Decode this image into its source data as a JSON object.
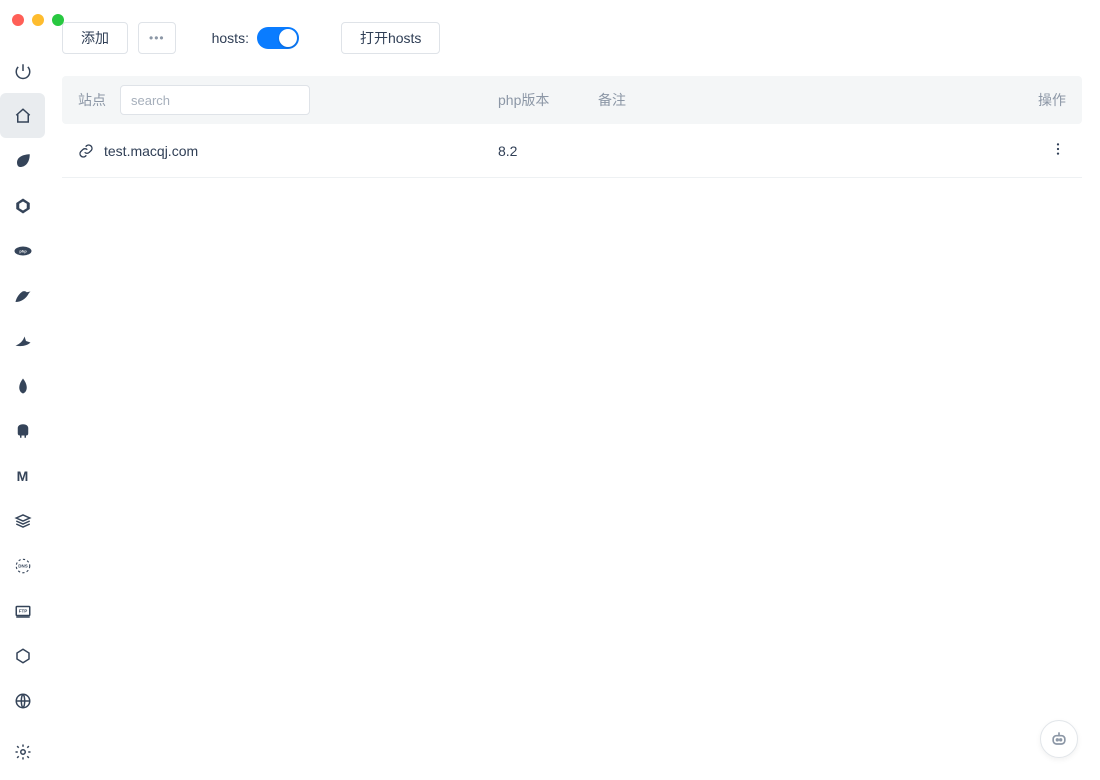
{
  "sidebar": {
    "items": [
      {
        "name": "power"
      },
      {
        "name": "home",
        "active": true
      },
      {
        "name": "leaf"
      },
      {
        "name": "geometric"
      },
      {
        "name": "php"
      },
      {
        "name": "bird"
      },
      {
        "name": "shark"
      },
      {
        "name": "mongo-leaf"
      },
      {
        "name": "elephant"
      },
      {
        "name": "letter-m"
      },
      {
        "name": "stack"
      },
      {
        "name": "dns"
      },
      {
        "name": "ftp"
      },
      {
        "name": "hex-node"
      },
      {
        "name": "globe"
      }
    ],
    "settings": {
      "name": "settings"
    }
  },
  "toolbar": {
    "add_label": "添加",
    "more_label": "•••",
    "hosts_label": "hosts:",
    "hosts_on": true,
    "open_hosts_label": "打开hosts"
  },
  "table": {
    "headers": {
      "site": "站点",
      "php": "php版本",
      "note": "备注",
      "op": "操作"
    },
    "search_placeholder": "search"
  },
  "rows": [
    {
      "site": "test.macqj.com",
      "php": "8.2",
      "note": ""
    }
  ]
}
